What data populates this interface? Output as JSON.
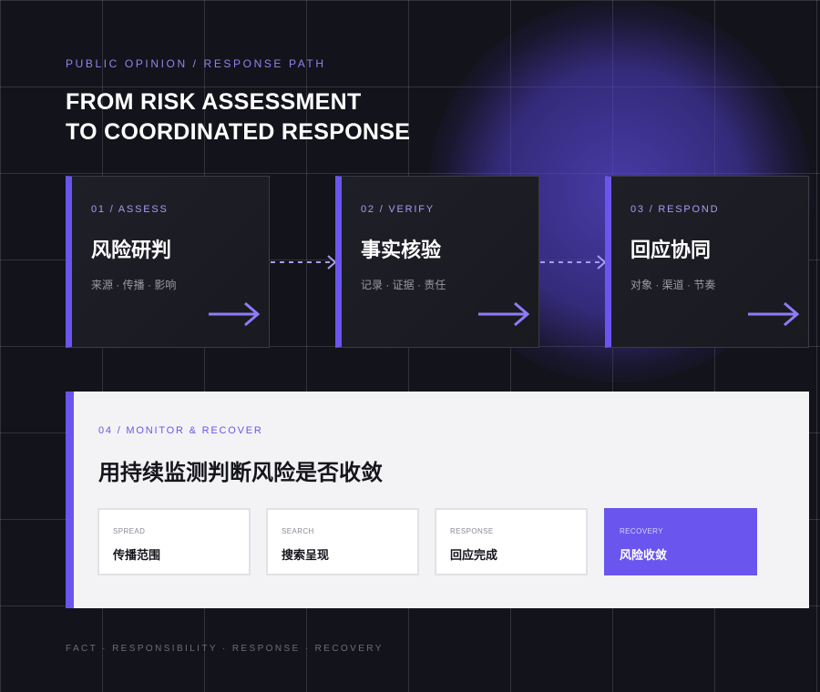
{
  "header": {
    "eyebrow": "PUBLIC OPINION / RESPONSE PATH",
    "title_line1": "FROM RISK ASSESSMENT",
    "title_line2": "TO COORDINATED RESPONSE"
  },
  "steps": [
    {
      "label": "01 / ASSESS",
      "title": "风险研判",
      "subtitle": "来源 · 传播 · 影响"
    },
    {
      "label": "02 / VERIFY",
      "title": "事实核验",
      "subtitle": "记录 · 证据 · 责任"
    },
    {
      "label": "03 / RESPOND",
      "title": "回应协同",
      "subtitle": "对象 · 渠道 · 节奏"
    }
  ],
  "panel": {
    "label": "04 / MONITOR & RECOVER",
    "title": "用持续监测判断风险是否收敛",
    "boxes": [
      {
        "key": "SPREAD",
        "value": "传播范围"
      },
      {
        "key": "SEARCH",
        "value": "搜索呈现"
      },
      {
        "key": "RESPONSE",
        "value": "回应完成"
      },
      {
        "key": "RECOVERY",
        "value": "风险收敛"
      }
    ]
  },
  "footer": "FACT · RESPONSIBILITY · RESPONSE · RECOVERY",
  "colors": {
    "accent": "#6a55ee",
    "background": "#13131b",
    "panel": "#f3f3f5"
  }
}
